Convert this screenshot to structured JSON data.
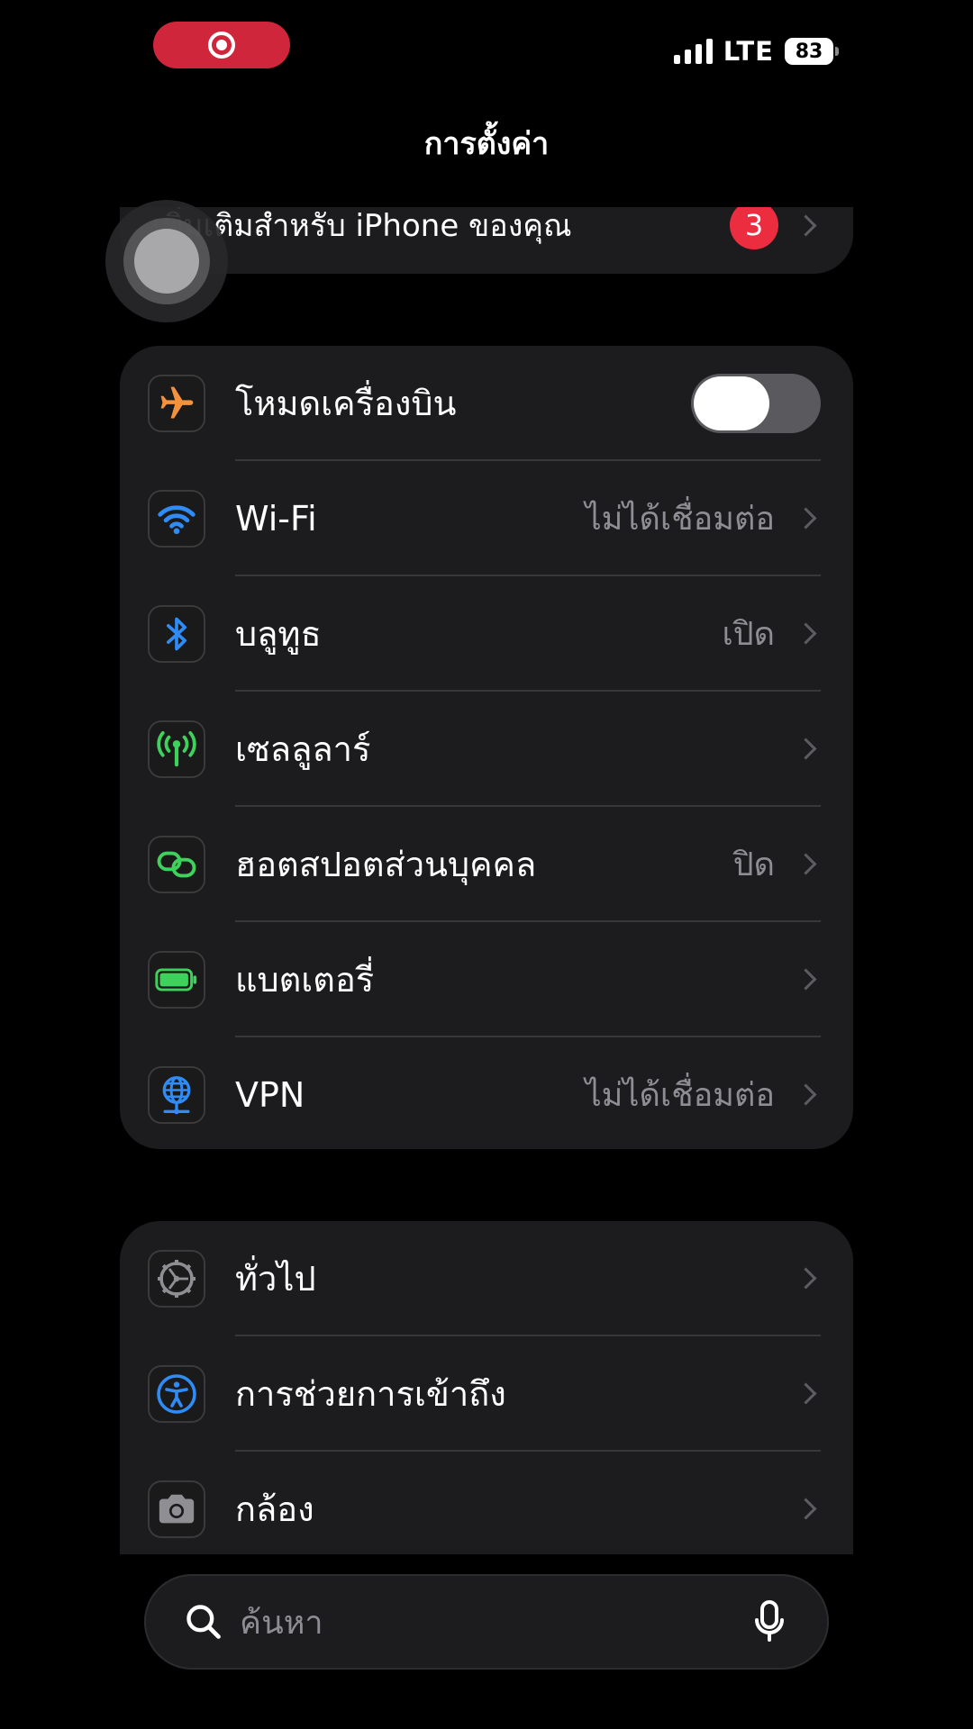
{
  "status_bar": {
    "network": "LTE",
    "battery": "83"
  },
  "nav": {
    "title": "การตั้งค่า"
  },
  "top_group": {
    "label": "เพิ่มเติมสำหรับ iPhone ของคุณ",
    "badge": "3"
  },
  "network_group": {
    "items": [
      {
        "label": "โหมดเครื่องบิน",
        "icon": "airplane-icon",
        "value": "",
        "toggle": "off"
      },
      {
        "label": "Wi-Fi",
        "icon": "wifi-icon",
        "value": "ไม่ได้เชื่อมต่อ"
      },
      {
        "label": "บลูทูธ",
        "icon": "bluetooth-icon",
        "value": "เปิด"
      },
      {
        "label": "เซลลูลาร์",
        "icon": "cellular-icon",
        "value": ""
      },
      {
        "label": "ฮอตสปอตส่วนบุคคล",
        "icon": "hotspot-icon",
        "value": "ปิด"
      },
      {
        "label": "แบตเตอรี่",
        "icon": "battery-icon",
        "value": ""
      },
      {
        "label": "VPN",
        "icon": "vpn-icon",
        "value": "ไม่ได้เชื่อมต่อ"
      }
    ]
  },
  "general_group": {
    "items": [
      {
        "label": "ทั่วไป",
        "icon": "gear-icon"
      },
      {
        "label": "การช่วยการเข้าถึง",
        "icon": "accessibility-icon"
      },
      {
        "label": "กล้อง",
        "icon": "camera-icon"
      }
    ]
  },
  "search": {
    "placeholder": "ค้นหา"
  },
  "colors": {
    "background": "#000000",
    "cell": "#1c1c1e",
    "secondary_text": "#8d8d93",
    "badge": "#eb2d3f",
    "recording": "#d0263b",
    "airplane": "#f4913c",
    "blue": "#2f8cf6",
    "green": "#3ed15c"
  }
}
